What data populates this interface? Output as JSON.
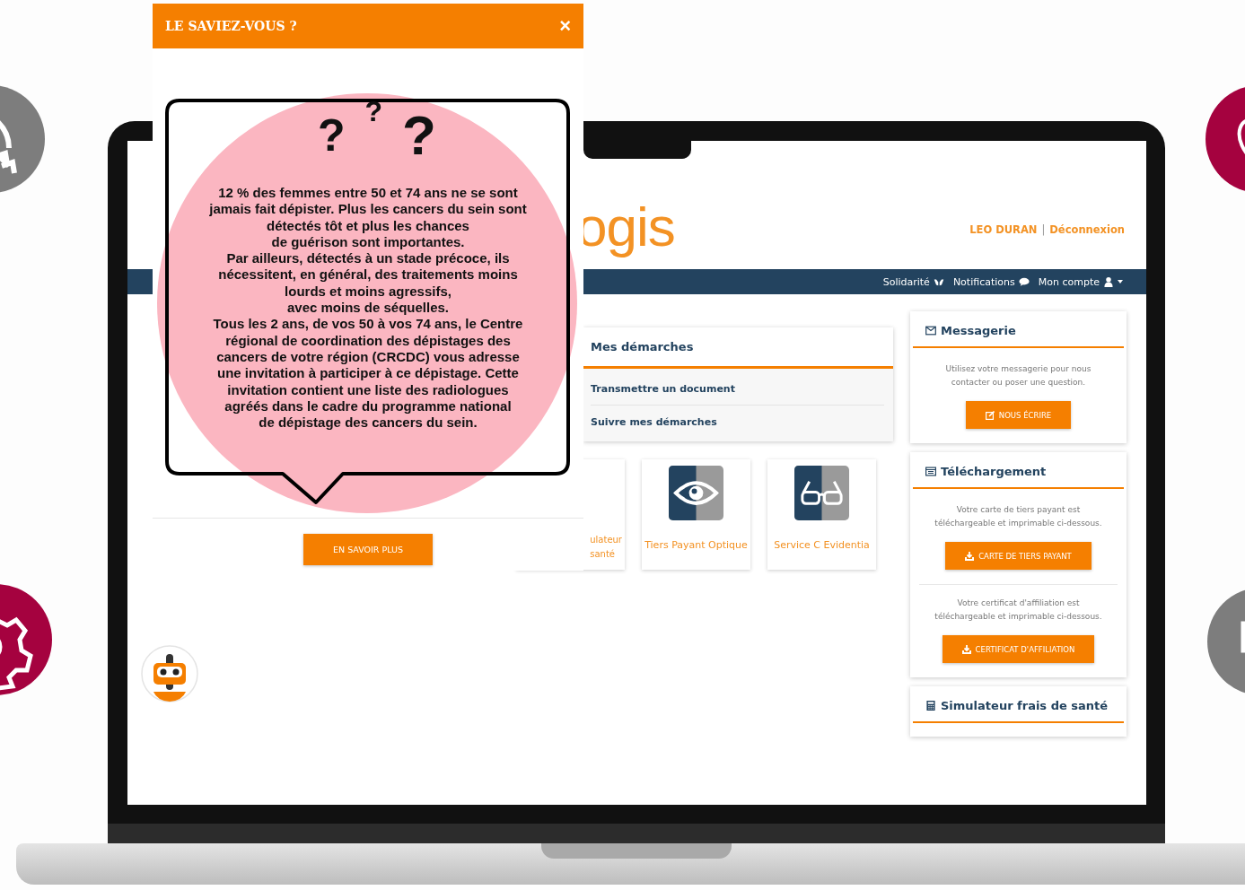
{
  "popup": {
    "title": "LE SAVIEZ-VOUS ?",
    "close": "×",
    "question_marks": [
      "?",
      "?",
      "?"
    ],
    "text": "12 % des femmes entre 50 et 74 ans ne se sont\njamais fait dépister. Plus les cancers du sein sont\ndétectés tôt et plus les chances\nde guérison sont importantes.\nPar ailleurs, détectés à un stade précoce, ils\nnécessitent, en général, des traitements moins\nlourds et moins agressifs,\navec moins de séquelles.\nTous les 2 ans, de vos 50 à vos 74 ans, le Centre\nrégional de coordination des dépistages des\ncancers de votre région (CRCDC) vous adresse\nune invitation à participer à ce dépistage. Cette\ninvitation contient une liste des radiologues\nagréés dans le cadre du programme national\nde dépistage des cancers du sein.",
    "button": "EN SAVOIR PLUS"
  },
  "site": {
    "logo": "ogis",
    "user": "LEO DURAN",
    "separator": "|",
    "logout": "Déconnexion",
    "nav": [
      {
        "kind": "solidarity",
        "label": "Solidarité"
      },
      {
        "kind": "notifications",
        "label": "Notifications"
      },
      {
        "kind": "account",
        "label": "Mon compte"
      }
    ],
    "demarches": {
      "title": "Mes démarches",
      "links": [
        "Transmettre un document",
        "Suivre mes démarches"
      ]
    },
    "tiles": [
      {
        "kind": "partial",
        "label": "ulateur\nsanté"
      },
      {
        "kind": "eye",
        "label": "Tiers Payant Optique"
      },
      {
        "kind": "glasses",
        "label": "Service C Evidentia"
      }
    ],
    "messagerie": {
      "title": "Messagerie",
      "text": "Utilisez votre messagerie pour nous\ncontacter ou poser une question.",
      "button": "NOUS ÉCRIRE"
    },
    "telechargement": {
      "title": "Téléchargement",
      "sections": [
        {
          "text": "Votre carte de tiers payant est\ntéléchargeable et imprimable ci-dessous.",
          "button": "CARTE DE TIERS PAYANT"
        },
        {
          "text": "Votre certificat d'affiliation est\ntéléchargeable et imprimable ci-dessous.",
          "button": "CERTIFICAT D'AFFILIATION"
        }
      ]
    },
    "simulateur": {
      "title": "Simulateur frais de santé"
    }
  }
}
